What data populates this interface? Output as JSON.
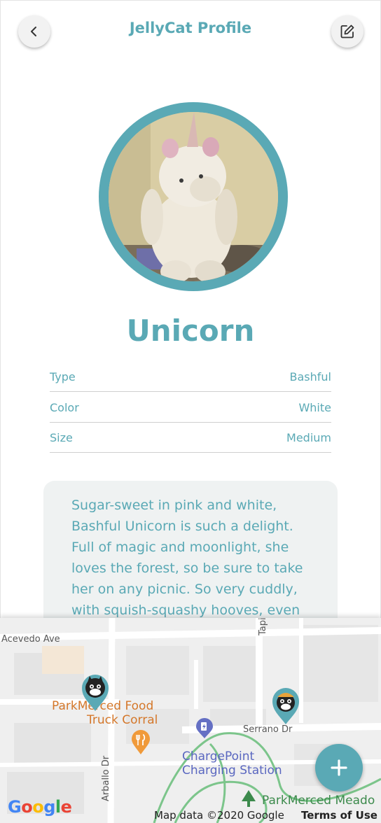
{
  "header": {
    "title": "JellyCat Profile",
    "back_icon": "chevron-left-icon",
    "edit_icon": "edit-icon"
  },
  "profile": {
    "name": "Unicorn",
    "details": [
      {
        "label": "Type",
        "value": "Bashful"
      },
      {
        "label": "Color",
        "value": "White"
      },
      {
        "label": "Size",
        "value": "Medium"
      }
    ],
    "description_lines": [
      "Sugar-sweet in pink and white,",
      "Bashful Unicorn is such a delight.",
      "Full of magic and moonlight, she",
      "loves the forest, so be sure to take",
      "her on any picnic. So very cuddly,",
      "with squish-squashy hooves, even"
    ]
  },
  "map": {
    "streets": [
      "Acevedo Ave",
      "Tapia Dr",
      "Serrano Dr",
      "Arballo Dr"
    ],
    "poi_food": [
      "ParkMerced Food",
      "Truck Corral"
    ],
    "poi_charging": [
      "ChargePoint",
      "Charging Station"
    ],
    "poi_park": "ParkMerced Meado",
    "google_logo": "Google",
    "attribution": "Map data ©2020 Google",
    "terms": "Terms of Use"
  },
  "fab": {
    "icon": "plus-icon"
  },
  "colors": {
    "accent": "#5aa9b5",
    "card": "#eff2f2",
    "food": "#d4772a",
    "charging": "#5a67c0",
    "park": "#3c8a4c"
  }
}
